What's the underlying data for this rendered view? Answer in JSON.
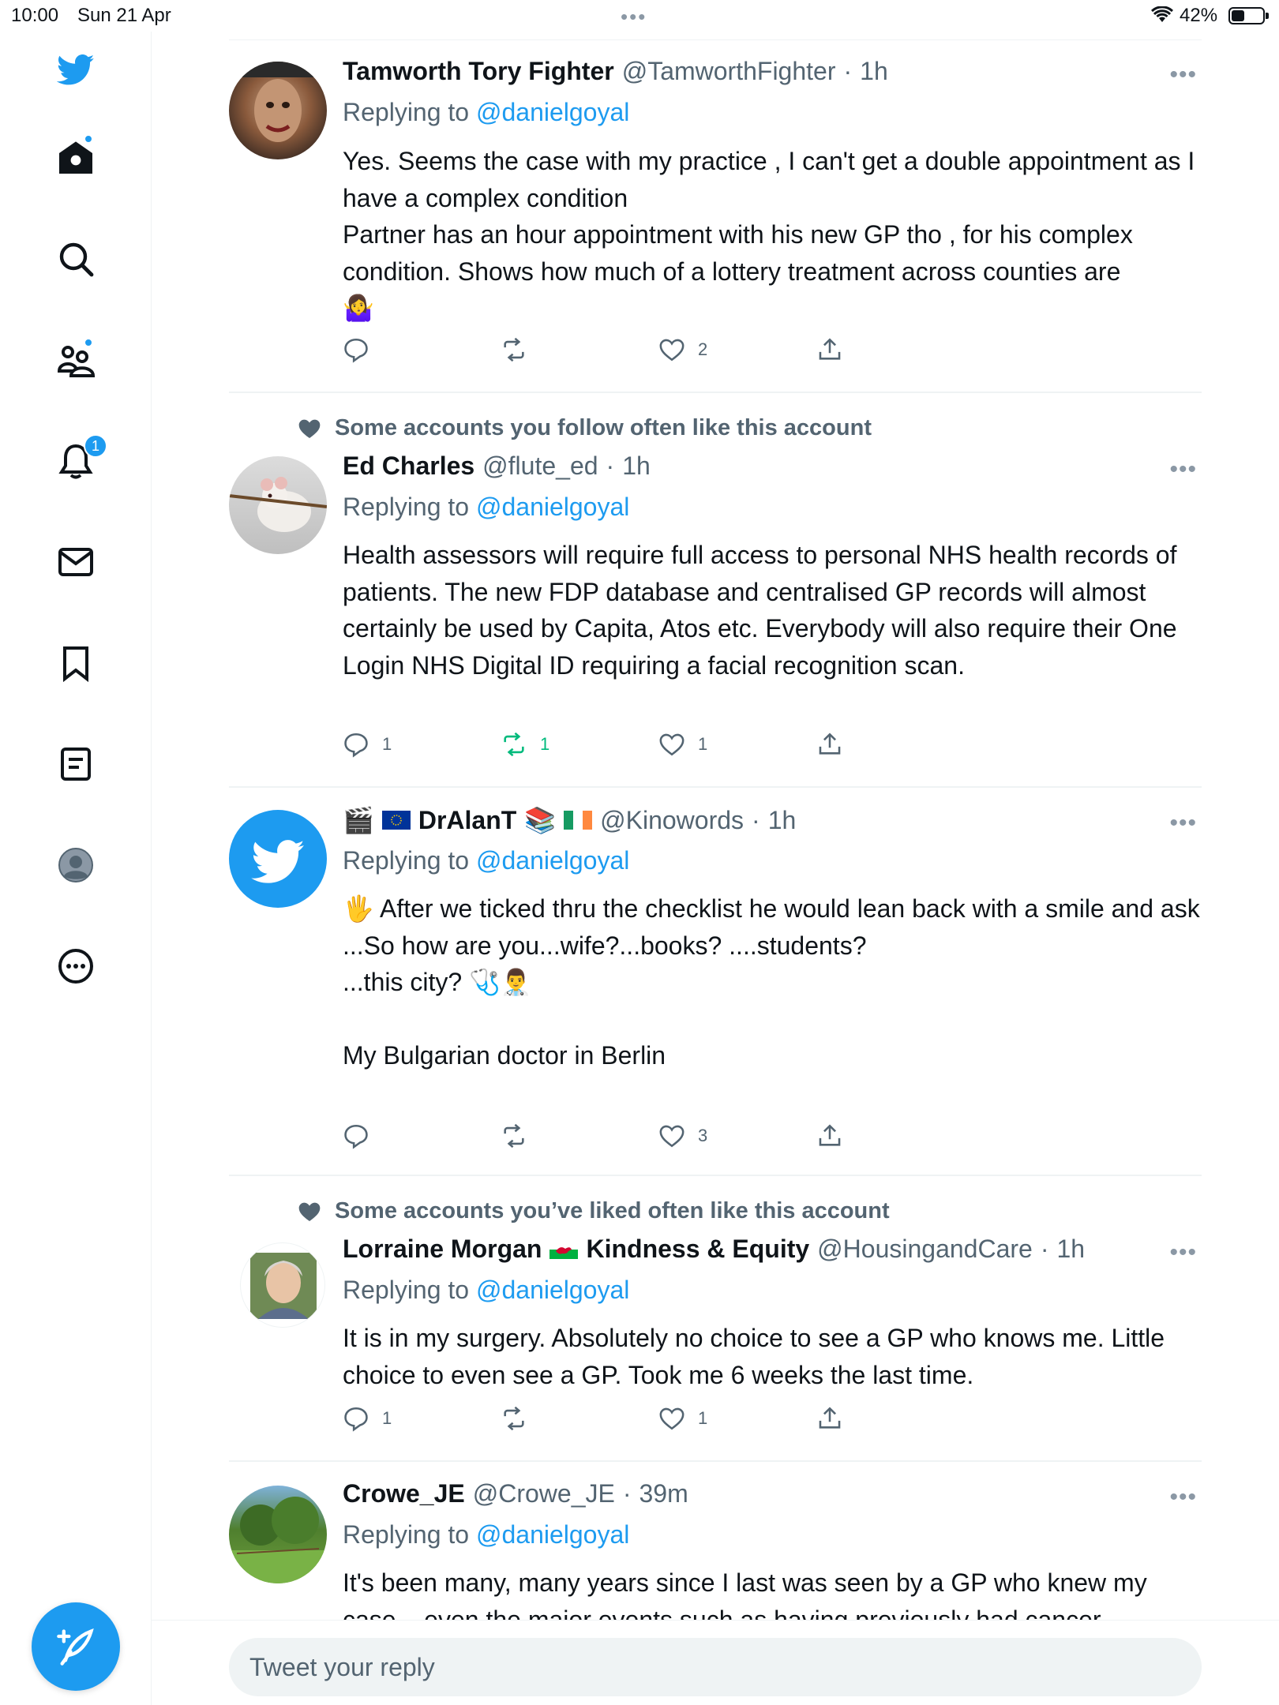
{
  "status_bar": {
    "time": "10:00",
    "date": "Sun 21 Apr",
    "battery": "42%"
  },
  "sidebar": {
    "items": [
      {
        "name": "twitter-logo"
      },
      {
        "name": "home",
        "badge": "dot"
      },
      {
        "name": "explore"
      },
      {
        "name": "communities",
        "badge": "dot"
      },
      {
        "name": "notifications",
        "badge_count": "1"
      },
      {
        "name": "messages"
      },
      {
        "name": "bookmarks"
      },
      {
        "name": "lists"
      },
      {
        "name": "profile"
      },
      {
        "name": "more"
      }
    ]
  },
  "tweets": [
    {
      "name": "Tamworth Tory Fighter",
      "handle": "@TamworthFighter",
      "time": "1h",
      "replying_label": "Replying to",
      "replying_to": "@danielgoyal",
      "body": "Yes. Seems the case with my practice , I can't get a double appointment as I have a complex condition\nPartner has an hour appointment with his new GP tho , for his complex condition. Shows how much of a lottery treatment across counties are\n🤷‍♀️",
      "replies": "",
      "retweets": "",
      "likes": "2"
    },
    {
      "social_context": "Some accounts you follow often like this account",
      "name": "Ed Charles",
      "handle": "@flute_ed",
      "time": "1h",
      "replying_label": "Replying to",
      "replying_to": "@danielgoyal",
      "body": "Health assessors will require full access to personal NHS health records of patients. The new FDP database and centralised GP records will almost certainly be used by Capita, Atos etc. Everybody will also require their One Login NHS Digital ID requiring a facial recognition scan.",
      "replies": "1",
      "retweets": "1",
      "likes": "1"
    },
    {
      "name_prefix": "🎬",
      "name": "DrAlanT",
      "name_suffix": "📚",
      "handle": "@Kinowords",
      "time": "1h",
      "replying_label": "Replying to",
      "replying_to": "@danielgoyal",
      "body": "🖐 After we ticked thru the checklist he would lean back with a smile and ask\n...So how are you...wife?...books? ....students?\n...this city? 🩺👨‍⚕️\n\nMy  Bulgarian doctor in Berlin",
      "replies": "",
      "retweets": "",
      "likes": "3"
    },
    {
      "social_context": "Some accounts you’ve liked often like this account",
      "name": "Lorraine Morgan",
      "name_suffix": "Kindness & Equity",
      "handle": "@HousingandCare",
      "time": "1h",
      "replying_label": "Replying to",
      "replying_to": "@danielgoyal",
      "body": "It is in my surgery.  Absolutely no choice to see a GP who knows me. Little choice to even see a GP.  Took me 6 weeks the last time.",
      "replies": "1",
      "retweets": "",
      "likes": "1"
    },
    {
      "name": "Crowe_JE",
      "handle": "@Crowe_JE",
      "time": "39m",
      "replying_label": "Replying to",
      "replying_to": "@danielgoyal",
      "body": "It's been many, many years since I last was seen by a GP who knew my case – even the major events such as having previously had cancer"
    }
  ],
  "reply_bar": {
    "placeholder": "Tweet your reply"
  },
  "colors": {
    "accent": "#1d9bf0",
    "retweet_active": "#00ba7c",
    "secondary_text": "#536471"
  }
}
